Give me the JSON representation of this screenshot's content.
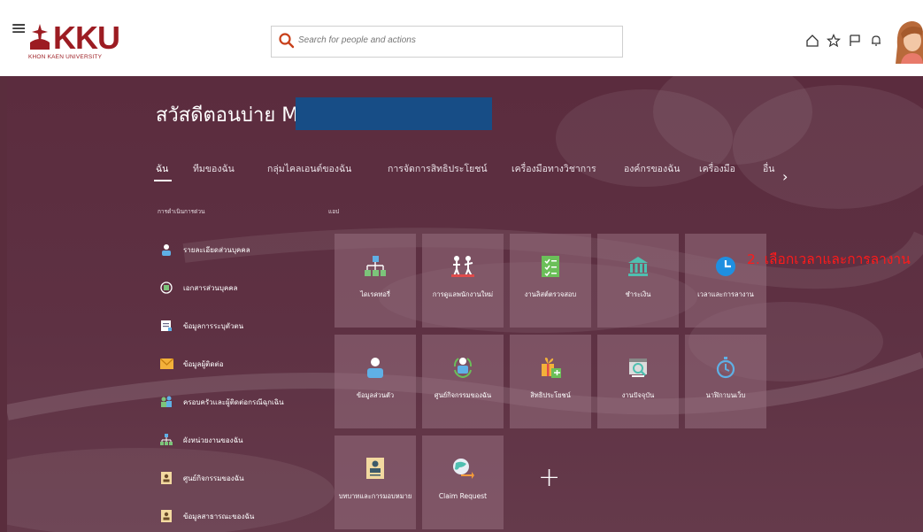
{
  "header": {
    "logo_text": "KKU",
    "logo_subtext": "KHON KAEN UNIVERSITY",
    "search_placeholder": "Search for people and actions",
    "icons": [
      "menu-icon",
      "home-icon",
      "star-icon",
      "flag-icon",
      "bell-icon",
      "avatar"
    ]
  },
  "greeting": "สวัสดีตอนบ่าย M",
  "tabs": [
    {
      "label": "ฉัน",
      "active": true
    },
    {
      "label": "ทีมของฉัน"
    },
    {
      "label": "กลุ่มไคลเอนต์ของฉัน"
    },
    {
      "label": "การจัดการสิทธิประโยชน์"
    },
    {
      "label": "เครื่องมือทางวิชาการ"
    },
    {
      "label": "องค์กรของฉัน"
    },
    {
      "label": "เครื่องมือ"
    },
    {
      "label": "อื่น"
    }
  ],
  "quick_actions_title": "การดำเนินการด่วน",
  "apps_title": "แอป",
  "quick_actions": [
    {
      "label": "รายละเอียดส่วนบุคคล",
      "icon": "person-icon"
    },
    {
      "label": "เอกสารส่วนบุคคล",
      "icon": "document-icon"
    },
    {
      "label": "ข้อมูลการระบุตัวตน",
      "icon": "id-icon"
    },
    {
      "label": "ข้อมูลผู้ติดต่อ",
      "icon": "mail-icon"
    },
    {
      "label": "ครอบครัวและผู้ติดต่อกรณีฉุกเฉิน",
      "icon": "family-icon"
    },
    {
      "label": "ผังหน่วยงานของฉัน",
      "icon": "org-chart-icon"
    },
    {
      "label": "ศูนย์กิจกรรมของฉัน",
      "icon": "activity-icon"
    },
    {
      "label": "ข้อมูลสาธารณะของฉัน",
      "icon": "public-info-icon"
    }
  ],
  "apps": [
    {
      "label": "ไดเรคทอรี่",
      "icon": "directory-icon"
    },
    {
      "label": "การดูแลพนักงานใหม่",
      "icon": "onboarding-icon"
    },
    {
      "label": "งานลิสต์ตรวจสอบ",
      "icon": "checklist-icon"
    },
    {
      "label": "ชำระเงิน",
      "icon": "bank-icon"
    },
    {
      "label": "เวลาและการลางาน",
      "icon": "clock-icon"
    },
    {
      "label": "ข้อมูลส่วนตัว",
      "icon": "personal-info-icon"
    },
    {
      "label": "ศูนย์กิจกรรมของฉัน",
      "icon": "activity-center-icon"
    },
    {
      "label": "สิทธิประโยชน์",
      "icon": "benefits-icon"
    },
    {
      "label": "งานปัจจุบัน",
      "icon": "current-job-icon"
    },
    {
      "label": "นาฬิกาบนเว็บ",
      "icon": "stopwatch-icon"
    },
    {
      "label": "บทบาทและการมอบหมาย",
      "icon": "roles-icon"
    },
    {
      "label": "Claim Request",
      "icon": "claim-icon"
    }
  ],
  "annotation": "2. เลือกเวลาและการลางาน",
  "colors": {
    "brand": "#9c1c22",
    "background": "#5a2d3d",
    "annotation": "#ff1a1a",
    "redaction": "#174d86"
  }
}
